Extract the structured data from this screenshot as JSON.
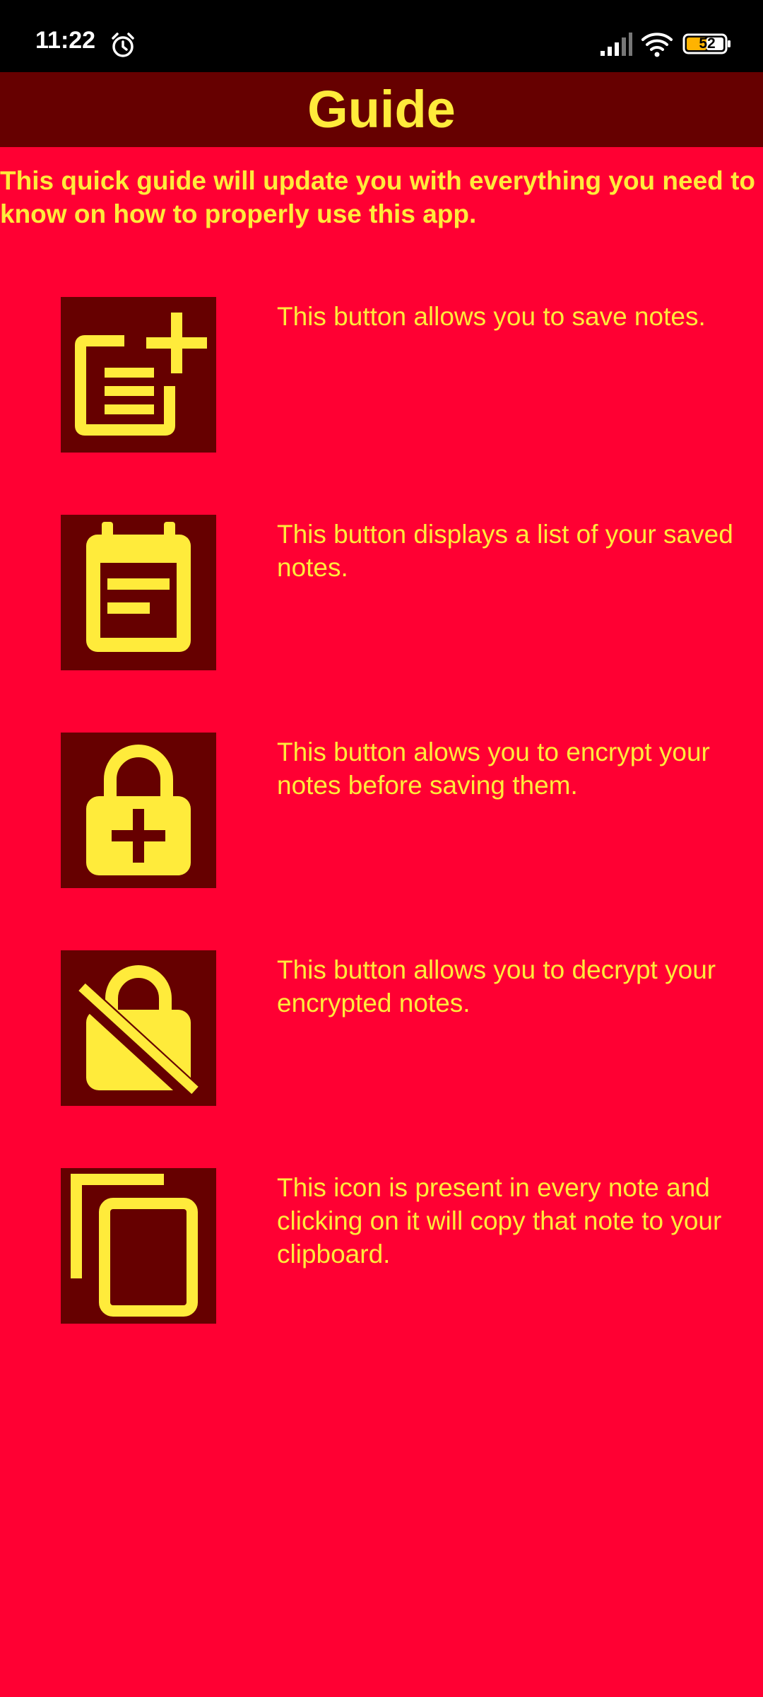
{
  "status_bar": {
    "time": "11:22",
    "battery": "52",
    "icons": [
      "alarm-icon",
      "signal-icon",
      "wifi-icon",
      "battery-icon"
    ]
  },
  "header": {
    "title": "Guide"
  },
  "intro": "This quick guide will update you with everything you need to know on how to properly use this app.",
  "guide_items": [
    {
      "icon": "note-add-icon",
      "text": "This button allows you to save notes."
    },
    {
      "icon": "notes-list-icon",
      "text": "This button displays a list of your saved notes."
    },
    {
      "icon": "lock-add-icon",
      "text": "This button alows you to encrypt your notes before saving them."
    },
    {
      "icon": "lock-off-icon",
      "text": "This button allows you to decrypt your encrypted notes."
    },
    {
      "icon": "copy-icon",
      "text": "This icon is present in every note and clicking on it will copy that note to your clipboard."
    }
  ],
  "colors": {
    "background": "#ff0033",
    "header_background": "#660000",
    "icon_background": "#660000",
    "text": "#ffeb3b",
    "status_bar": "#000000"
  }
}
